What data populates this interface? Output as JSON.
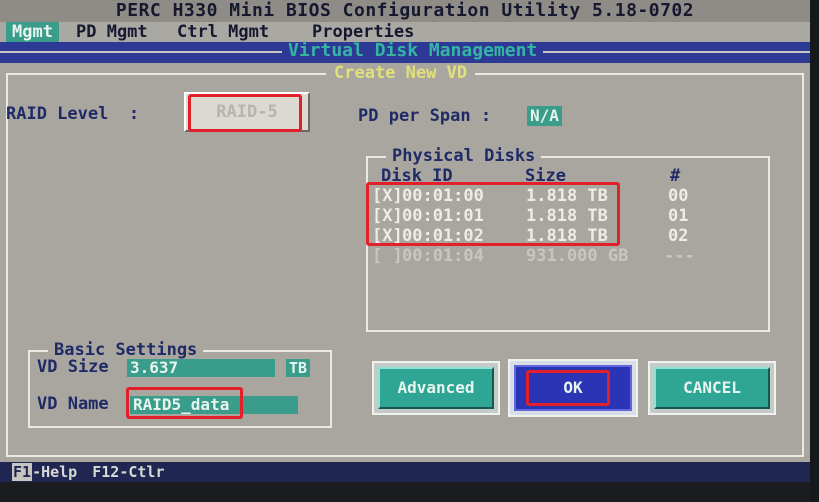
{
  "window": {
    "title": "PERC H330 Mini BIOS Configuration Utility 5.18-0702"
  },
  "menu": {
    "items": [
      "Mgmt",
      "PD Mgmt",
      "Ctrl Mgmt",
      "Properties"
    ],
    "active_index": 0
  },
  "section_title": "Virtual Disk Management",
  "dialog": {
    "title": "Create New VD",
    "raid_level_label": "RAID Level  :",
    "raid_level_value": "RAID-5",
    "pd_per_span_label": "PD per Span :",
    "pd_per_span_value": "N/A",
    "physical_disks": {
      "title": "Physical Disks",
      "headers": {
        "disk_id": "Disk ID",
        "size": "Size",
        "num": "#"
      },
      "rows": [
        {
          "check": "[X]",
          "id": "00:01:00",
          "size": "1.818 TB",
          "num": "00",
          "selected": true
        },
        {
          "check": "[X]",
          "id": "00:01:01",
          "size": "1.818 TB",
          "num": "01",
          "selected": true
        },
        {
          "check": "[X]",
          "id": "00:01:02",
          "size": "1.818 TB",
          "num": "02",
          "selected": true
        },
        {
          "check": "[ ]",
          "id": "00:01:04",
          "size": "931.000 GB",
          "num": "---",
          "selected": false
        }
      ]
    },
    "basic_settings": {
      "title": "Basic Settings",
      "vd_size_label": "VD Size",
      "vd_size_value": "3.637",
      "vd_size_unit": "TB",
      "vd_name_label": "VD Name",
      "vd_name_value": "RAID5_data"
    },
    "buttons": {
      "advanced": "Advanced",
      "ok": "OK",
      "cancel": "CANCEL"
    }
  },
  "status_bar": {
    "help_key": "F1",
    "help_text": "-Help",
    "ctrl_key": "F12",
    "ctrl_text": "-Ctlr"
  },
  "colors": {
    "screen_bg": "#2c3a96",
    "dialog_bg": "#a9a6a0",
    "field_teal": "#3a9c8b",
    "highlight_red": "#e2202a",
    "ok_button_blue": "#2b34b4"
  }
}
